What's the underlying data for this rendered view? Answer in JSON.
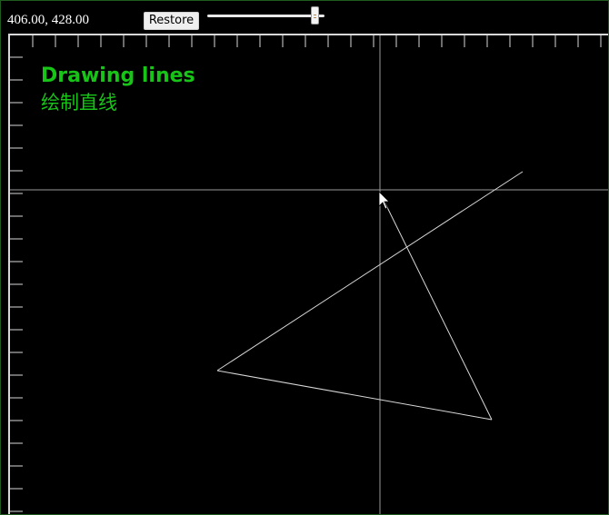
{
  "toolbar": {
    "coordinate_readout": "406.00, 428.00",
    "restore_label": "Restore",
    "zoom_slider": {
      "value_fraction": 0.92
    }
  },
  "canvas": {
    "heading": "Drawing lines",
    "subheading": "绘制直线",
    "colors": {
      "background": "#000000",
      "heading_text": "#17c417",
      "lines": "#d8d8d8",
      "ruler": "#d8d8d8",
      "crosshair": "#9a9a9a",
      "frame_border": "#1f5a1f"
    },
    "cursor_icon": "arrow-cursor-icon"
  }
}
